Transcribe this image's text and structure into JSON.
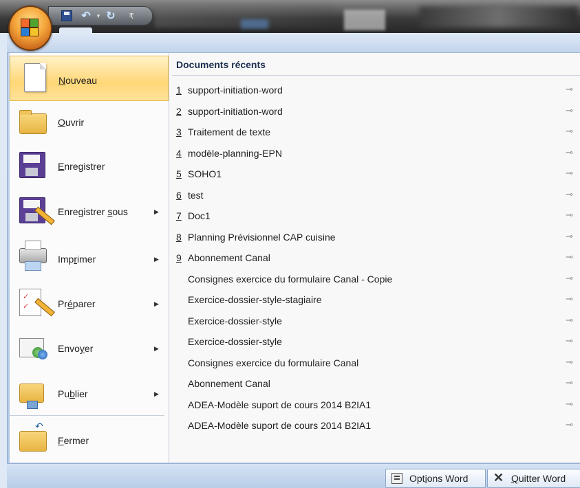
{
  "quick_access": {
    "save_icon": "save-icon",
    "undo_icon": "undo-icon",
    "redo_icon": "redo-icon",
    "customize_icon": "customize-qat-icon"
  },
  "office_button": {
    "icon": "office-logo"
  },
  "menu": {
    "commands": [
      {
        "key": "N",
        "label": "Nouveau",
        "pre": "",
        "rest": "ouveau",
        "has_arrow": false,
        "active": true,
        "icon": "new-document-icon"
      },
      {
        "key": "O",
        "label": "Ouvrir",
        "pre": "",
        "rest": "uvrir",
        "has_arrow": false,
        "active": false,
        "icon": "open-folder-icon"
      },
      {
        "key": "E",
        "label": "Enregistrer",
        "pre": "",
        "rest": "nregistrer",
        "has_arrow": false,
        "active": false,
        "icon": "save-disk-icon"
      },
      {
        "key": "s",
        "label": "Enregistrer sous",
        "pre": "Enregistrer ",
        "rest": "ous",
        "has_arrow": true,
        "active": false,
        "icon": "save-as-icon"
      },
      {
        "key": "r",
        "label": "Imprimer",
        "pre": "Imp",
        "rest": "imer",
        "has_arrow": true,
        "active": false,
        "icon": "printer-icon"
      },
      {
        "key": "é",
        "label": "Préparer",
        "pre": "Pr",
        "rest": "parer",
        "has_arrow": true,
        "active": false,
        "icon": "prepare-icon"
      },
      {
        "key": "y",
        "label": "Envoyer",
        "pre": "Envo",
        "rest": "er",
        "has_arrow": true,
        "active": false,
        "icon": "send-icon"
      },
      {
        "key": "b",
        "label": "Publier",
        "pre": "Pu",
        "rest": "lier",
        "has_arrow": true,
        "active": false,
        "icon": "publish-icon"
      },
      {
        "key": "F",
        "label": "Fermer",
        "pre": "",
        "rest": "ermer",
        "has_arrow": false,
        "active": false,
        "icon": "close-folder-icon"
      }
    ]
  },
  "recent": {
    "title": "Documents récents",
    "pin_icon": "pin-icon",
    "items": [
      {
        "num": "1",
        "name": "support-initiation-word"
      },
      {
        "num": "2",
        "name": "support-initiation-word"
      },
      {
        "num": "3",
        "name": "Traitement de texte"
      },
      {
        "num": "4",
        "name": "modèle-planning-EPN"
      },
      {
        "num": "5",
        "name": "SOHO1"
      },
      {
        "num": "6",
        "name": "test"
      },
      {
        "num": "7",
        "name": "Doc1"
      },
      {
        "num": "8",
        "name": "Planning Prévisionnel CAP cuisine"
      },
      {
        "num": "9",
        "name": "Abonnement Canal"
      },
      {
        "num": "",
        "name": "Consignes exercice du formulaire Canal - Copie"
      },
      {
        "num": "",
        "name": "Exercice-dossier-style-stagiaire"
      },
      {
        "num": "",
        "name": "Exercice-dossier-style"
      },
      {
        "num": "",
        "name": "Exercice-dossier-style"
      },
      {
        "num": "",
        "name": "Consignes exercice du formulaire Canal"
      },
      {
        "num": "",
        "name": "Abonnement Canal"
      },
      {
        "num": "",
        "name": "ADEA-Modèle suport de cours 2014 B2IA1"
      },
      {
        "num": "",
        "name": "ADEA-Modèle suport de cours 2014 B2IA1"
      }
    ]
  },
  "footer": {
    "options": {
      "pre": "Opt",
      "key": "i",
      "rest": "ons Word",
      "icon": "options-icon"
    },
    "quit": {
      "pre": "",
      "key": "Q",
      "rest": "uitter Word",
      "icon": "close-x-icon"
    }
  }
}
